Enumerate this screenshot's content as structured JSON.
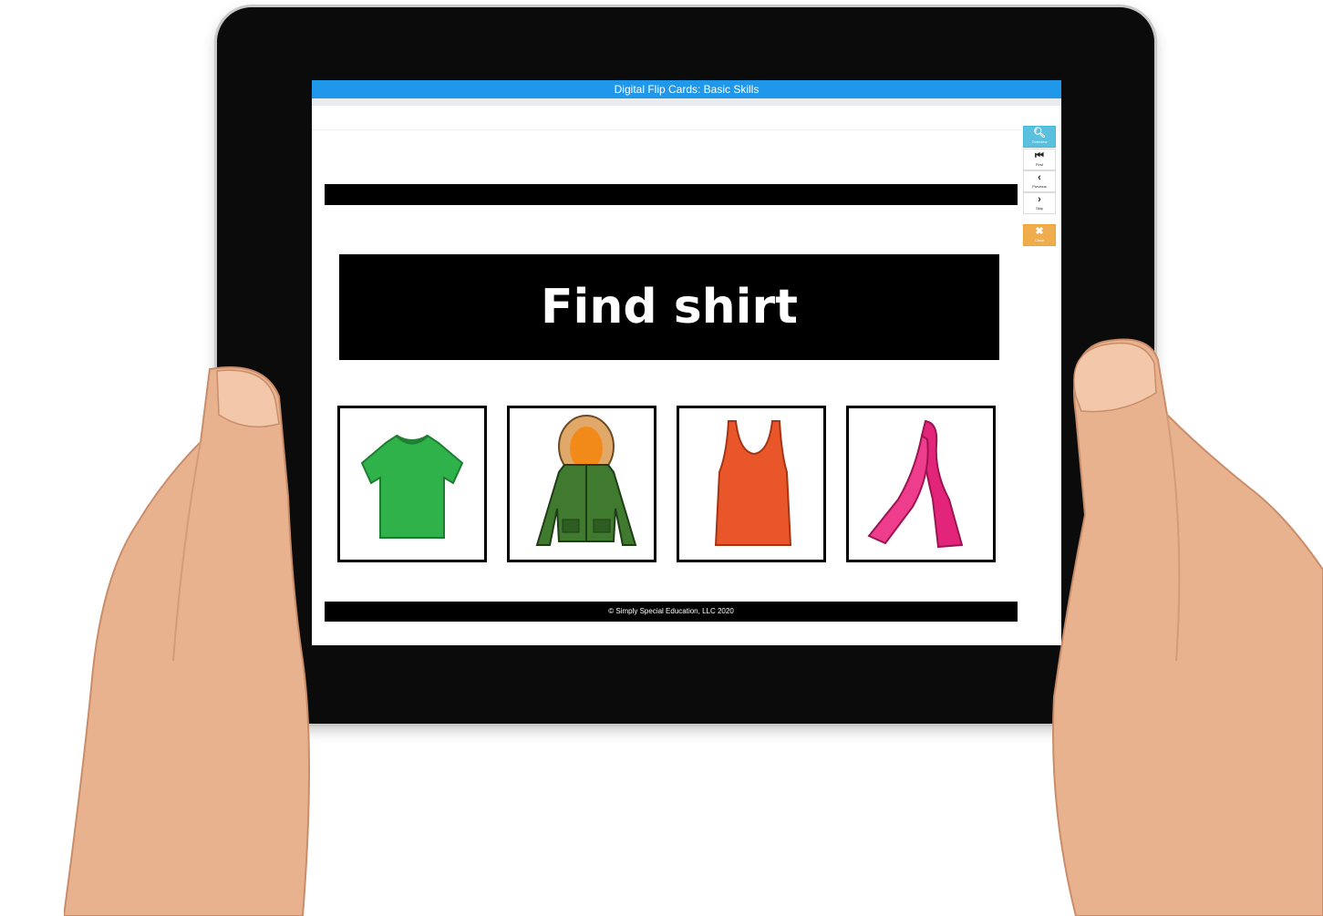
{
  "window": {
    "title": "Digital Flip Cards: Basic Skills"
  },
  "prompt": {
    "text": "Find shirt"
  },
  "choices": [
    {
      "item": "t-shirt",
      "color": "#2fb24a"
    },
    {
      "item": "jacket",
      "color": "#3f7a2f"
    },
    {
      "item": "tank-top",
      "color": "#e8562a"
    },
    {
      "item": "scarf",
      "color": "#e2257a"
    }
  ],
  "toolbar": {
    "overview": {
      "icon": "search-icon",
      "label": "Overview"
    },
    "first": {
      "icon": "skip-first-icon",
      "label": "First"
    },
    "previous": {
      "icon": "chevron-left-icon",
      "label": "Previous"
    },
    "skip": {
      "icon": "chevron-right-icon",
      "label": "Skip"
    },
    "close": {
      "icon": "close-icon",
      "label": "Close"
    }
  },
  "footer": {
    "text": "© Simply Special Education, LLC 2020"
  },
  "colors": {
    "titlebar": "#1f97ea",
    "close_button": "#f0ad4e",
    "overview_button": "#5bc0de"
  }
}
